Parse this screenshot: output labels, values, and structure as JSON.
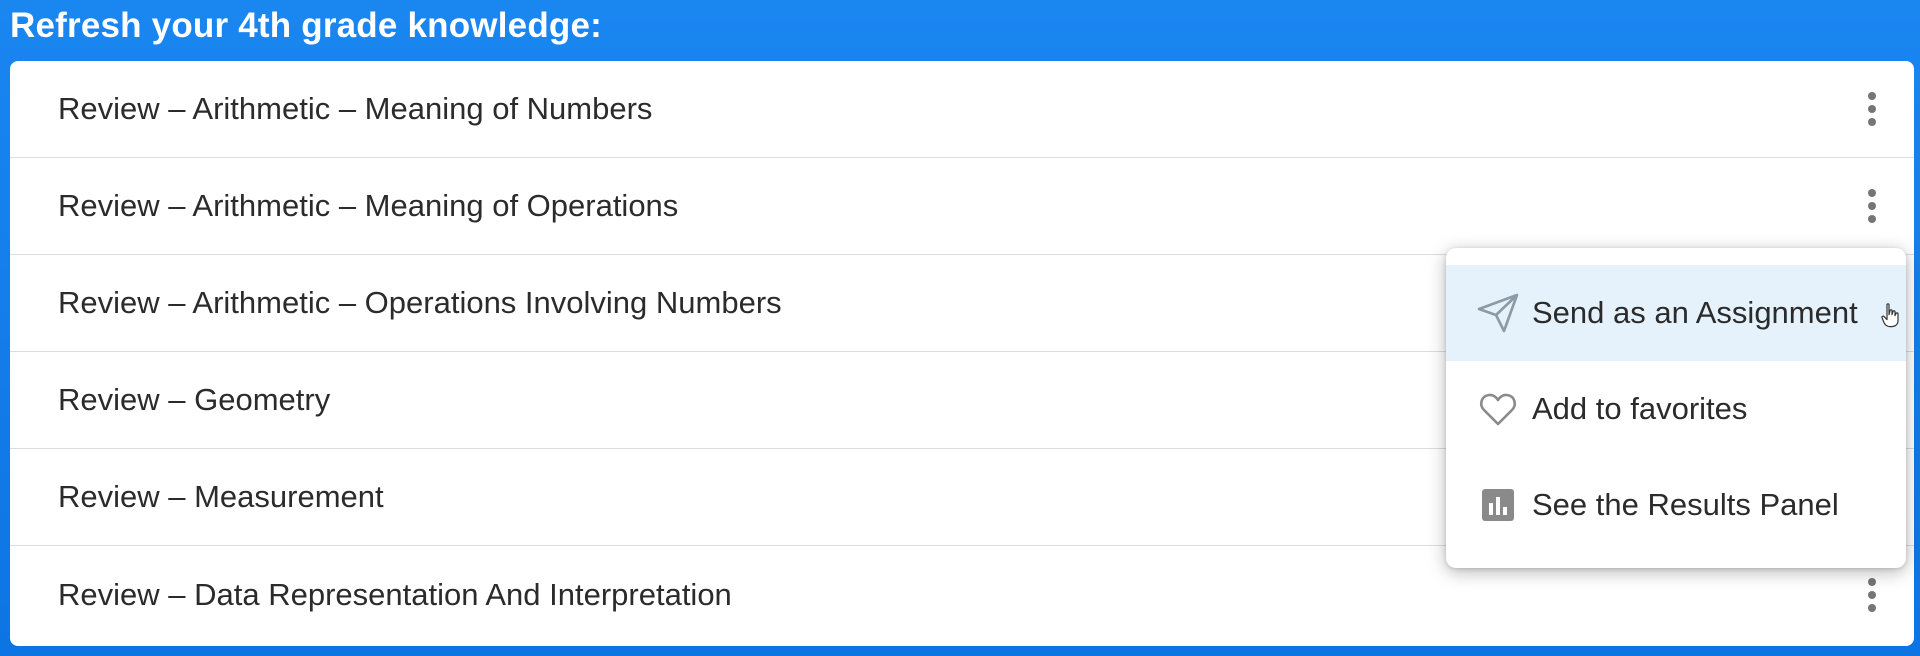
{
  "header": {
    "title": "Refresh your 4th grade knowledge:"
  },
  "list": {
    "items": [
      {
        "label": "Review – Arithmetic – Meaning of Numbers",
        "menu_icon": "kebab-menu-icon"
      },
      {
        "label": "Review – Arithmetic – Meaning of Operations",
        "menu_icon": "kebab-menu-icon"
      },
      {
        "label": "Review – Arithmetic – Operations Involving Numbers",
        "menu_icon": "kebab-menu-icon"
      },
      {
        "label": "Review – Geometry",
        "menu_icon": "kebab-menu-icon"
      },
      {
        "label": "Review – Measurement",
        "menu_icon": "kebab-menu-icon"
      },
      {
        "label": "Review – Data Representation And Interpretation",
        "menu_icon": "kebab-menu-icon"
      }
    ]
  },
  "context_menu": {
    "items": [
      {
        "label": "Send as an Assignment",
        "icon": "send-icon",
        "active": true
      },
      {
        "label": "Add to favorites",
        "icon": "heart-icon",
        "active": false
      },
      {
        "label": "See the Results Panel",
        "icon": "bar-chart-icon",
        "active": false
      }
    ]
  },
  "colors": {
    "background": "#0d74e4",
    "card": "#ffffff",
    "menu_hover": "#e5f2fc",
    "text": "#2b2b2b",
    "icon": "#757575"
  }
}
